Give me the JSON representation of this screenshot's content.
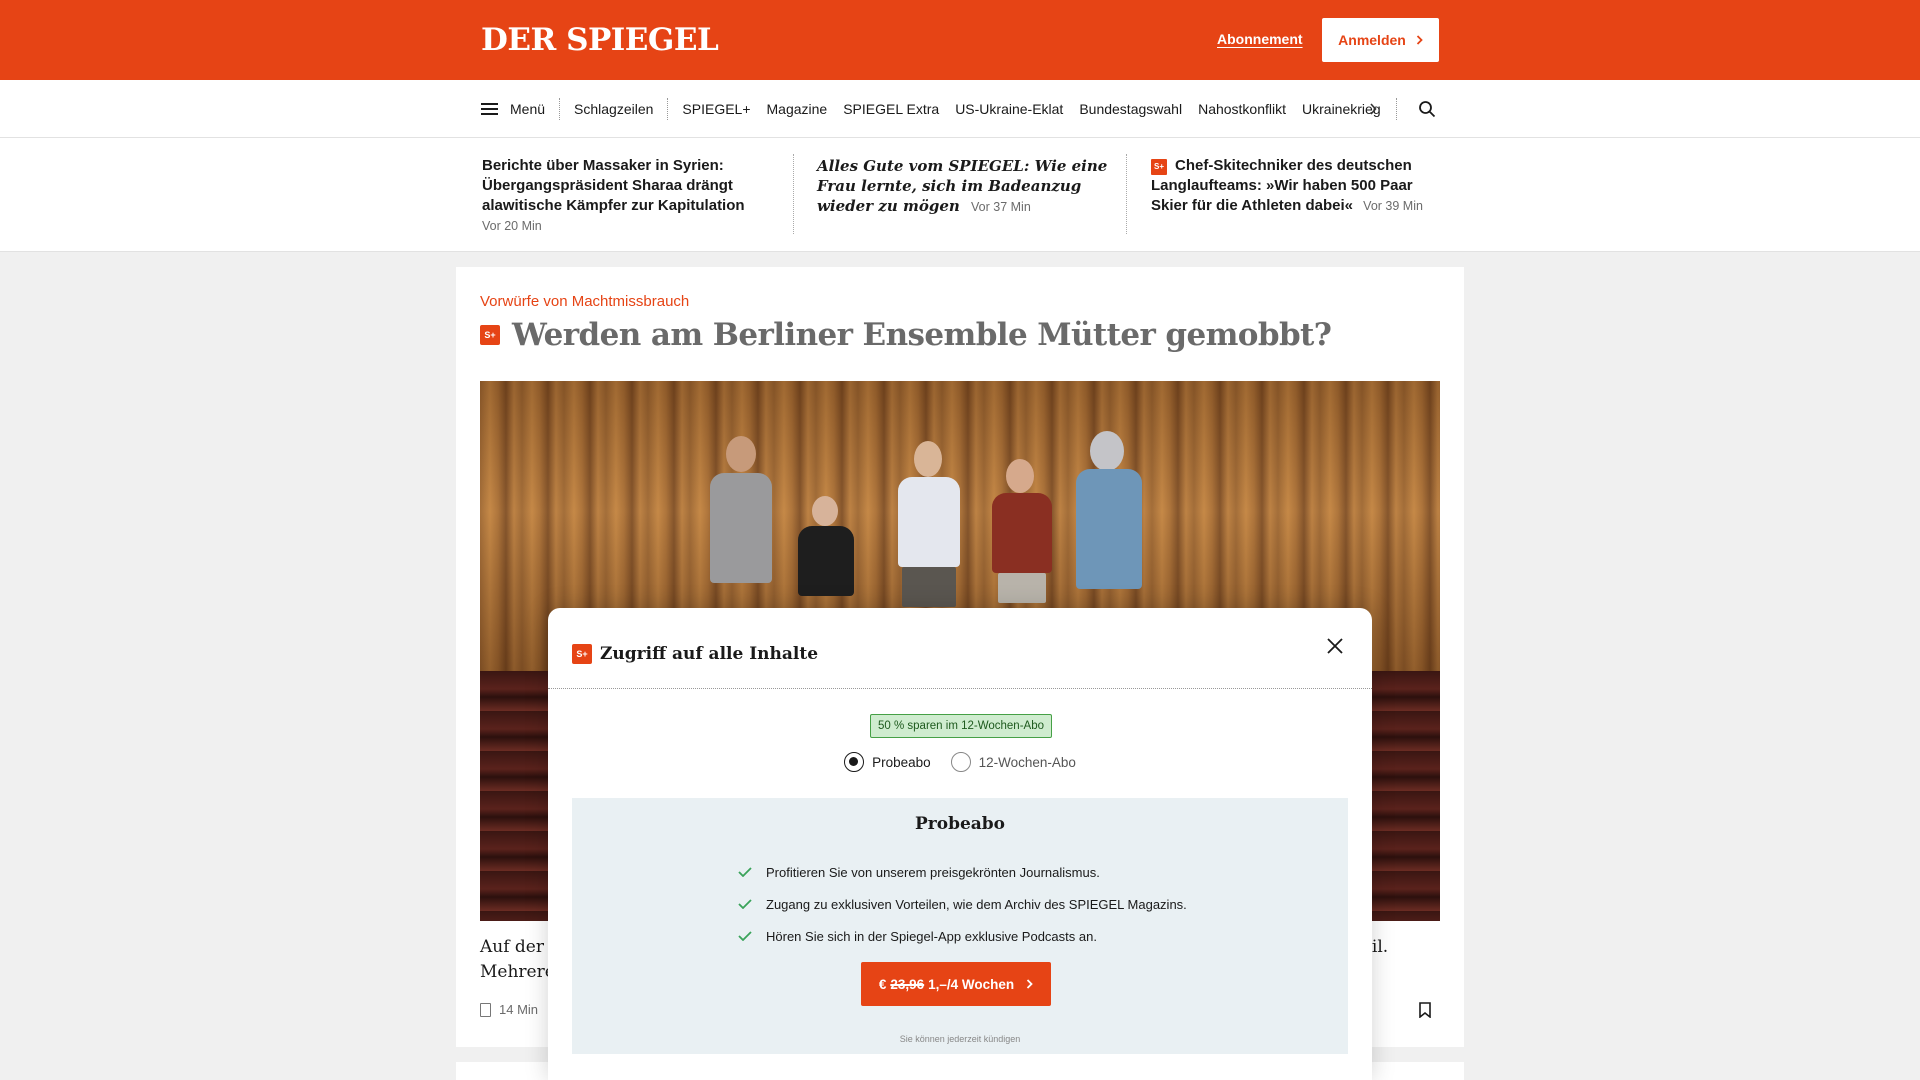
{
  "header": {
    "logo": "DER SPIEGEL",
    "abo_link": "Abonnement",
    "login_label": "Anmelden"
  },
  "nav": {
    "menu_label": "Menü",
    "items": [
      "Schlagzeilen",
      "SPIEGEL+",
      "Magazine",
      "SPIEGEL Extra",
      "US-Ukraine-Eklat",
      "Bundestagswahl",
      "Nahostkonflikt",
      "Ukrainekrieg"
    ],
    "more_icon": "chevron-right-icon",
    "search_icon": "search-icon"
  },
  "teasers": [
    {
      "title": "Berichte über Massaker in Syrien: Übergangspräsident Sharaa drängt alawitische Kämpfer zur Kapitulation",
      "time": "Vor 20 Min"
    },
    {
      "title": "Alles Gute vom SPIEGEL: Wie eine Frau lernte, sich im Badeanzug wieder zu mögen",
      "time": "Vor 37 Min"
    },
    {
      "title": "Chef-Skitechniker des deutschen Langlaufteams: »Wir haben 500 Paar Skier für die Athleten dabei«",
      "time": "Vor 39 Min",
      "badge": "S+"
    }
  ],
  "article": {
    "kicker": "Vorwürfe von Machtmissbrauch",
    "badge": "S+",
    "headline": "Werden am Berliner Ensemble Mütter gemobbt?",
    "lead_line1": "Auf der I",
    "lead_line2": "Mehrere",
    "lead_tail": "teil.",
    "read_time": "14 Min"
  },
  "modal": {
    "badge": "S+",
    "title": "Zugriff auf alle Inhalte",
    "save_badge": "50 % sparen im 12-Wochen-Abo",
    "options": [
      "Probeabo",
      "12-Wochen-Abo"
    ],
    "selected": "Probeabo",
    "plan_title": "Probeabo",
    "benefits": [
      "Profitieren Sie von unserem preisgekrönten Journalismus.",
      "Zugang zu exklusiven Vorteilen, wie dem Archiv des SPIEGEL Magazins.",
      "Hören Sie sich in der Spiegel-App exklusive Podcasts an."
    ],
    "cta_prefix": "€",
    "cta_old_price": "23,96",
    "cta_price": "1,–/4 Wochen",
    "cancel_note": "Sie können jederzeit kündigen"
  },
  "colors": {
    "brand": "#e64415",
    "save_green": "#46a046"
  }
}
